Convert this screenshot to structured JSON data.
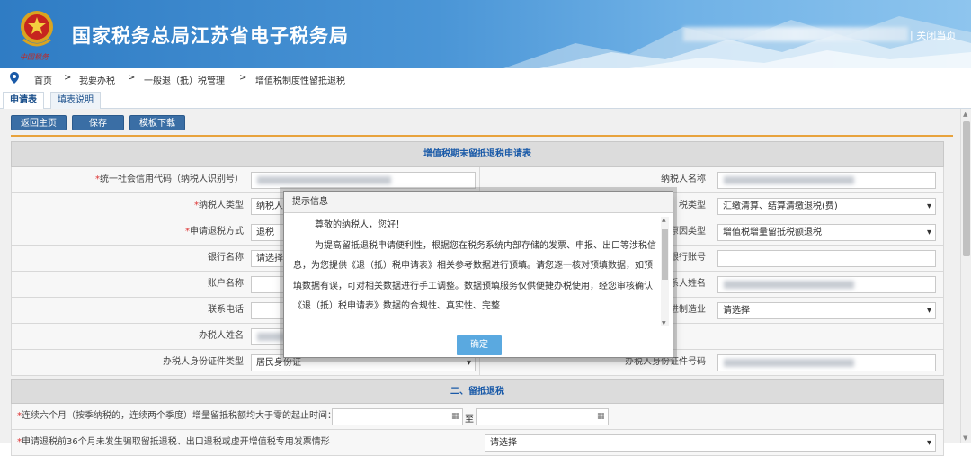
{
  "header": {
    "site_title": "国家税务总局江苏省电子税务局",
    "logo_caption": "中国税务",
    "close_link": "| 关闭当页"
  },
  "breadcrumb": {
    "items": [
      "首页",
      ">",
      "我要办税",
      ">",
      "一般退（抵）税管理",
      ">",
      "增值税制度性留抵退税"
    ]
  },
  "tabs": [
    {
      "label": "申请表",
      "active": true
    },
    {
      "label": "填表说明",
      "active": false
    }
  ],
  "toolbar": {
    "back_label": "返回主页",
    "save_label": "保存",
    "template_label": "模板下载"
  },
  "form": {
    "section1_title": "增值税期末留抵退税申请表",
    "section2_title": "二、留抵退税",
    "rows": [
      {
        "left_label": "统一社会信用代码（纳税人识别号）",
        "left_required": true,
        "left_value": "",
        "right_label": "纳税人名称",
        "right_value": ""
      },
      {
        "left_label": "纳税人类型",
        "left_required": true,
        "left_value": "纳税人",
        "right_label": "税类型",
        "right_value": "汇缴清算、结算清缴退税(费)"
      },
      {
        "left_label": "申请退税方式",
        "left_required": true,
        "left_value": "退税",
        "right_label": "原因类型",
        "right_value": "增值税增量留抵税额退税"
      },
      {
        "left_label": "银行名称",
        "left_required": false,
        "left_value": "请选择",
        "right_label": "银行账号",
        "right_value": ""
      },
      {
        "left_label": "账户名称",
        "left_required": false,
        "left_value": "",
        "right_label": "联系人姓名",
        "right_value": ""
      },
      {
        "left_label": "联系电话",
        "left_required": false,
        "left_value": "",
        "right_label": "先进制造业",
        "right_value": "请选择"
      },
      {
        "left_label": "办税人姓名",
        "left_required": false,
        "left_value": "",
        "right_label": "",
        "right_value": ""
      },
      {
        "left_label": "办税人身份证件类型",
        "left_required": false,
        "left_value": "居民身份证",
        "right_label": "办税人身份证件号码",
        "right_value": ""
      }
    ],
    "row_period_label": "连续六个月（按季纳税的，连续两个季度）增量留抵税额均大于零的起止时间：",
    "row_period_to": "至",
    "row_last_label": "申请退税前36个月未发生骗取留抵退税、出口退税或虚开增值税专用发票情形",
    "row_last_value": "请选择"
  },
  "dialog": {
    "title": "提示信息",
    "greeting": "尊敬的纳税人，您好！",
    "body": "为提高留抵退税申请便利性，根据您在税务系统内部存储的发票、申报、出口等涉税信息，为您提供《退（抵）税申请表》相关参考数据进行预填。请您逐一核对预填数据，如预填数据有误，可对相关数据进行手工调整。数据预填服务仅供便捷办税使用，经您审核确认《退（抵）税申请表》数据的合规性、真实性、完整",
    "ok_label": "确定"
  },
  "colors": {
    "header_blue": "#2f7cc4",
    "accent_orange": "#e8a33d",
    "ok_button": "#5aa9e0",
    "section_title": "#1a5aa8"
  }
}
